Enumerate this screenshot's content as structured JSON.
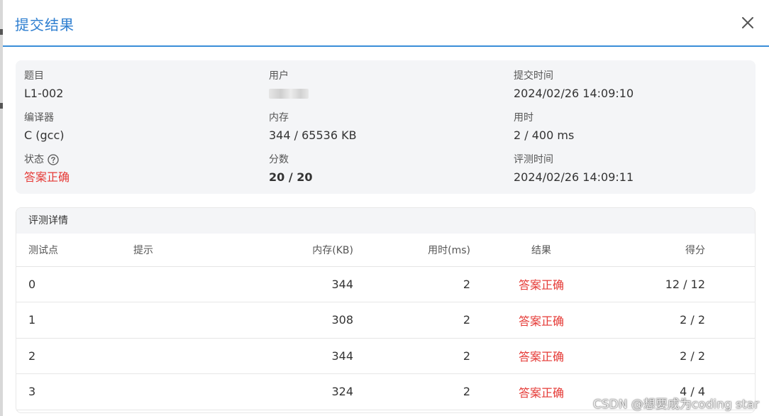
{
  "dialog": {
    "title": "提交结果",
    "accent": "#2f7fd0"
  },
  "info": {
    "problem": {
      "label": "题目",
      "value": "L1-002"
    },
    "user": {
      "label": "用户",
      "value": ""
    },
    "submit_time": {
      "label": "提交时间",
      "value": "2024/02/26 14:09:10"
    },
    "compiler": {
      "label": "编译器",
      "value": "C (gcc)"
    },
    "memory": {
      "label": "内存",
      "value": "344 / 65536 KB"
    },
    "time_used": {
      "label": "用时",
      "value": "2 / 400 ms"
    },
    "status": {
      "label": "状态",
      "value": "答案正确",
      "color": "#e53935"
    },
    "score": {
      "label": "分数",
      "value": "20 / 20"
    },
    "judge_time": {
      "label": "评测时间",
      "value": "2024/02/26 14:09:11"
    }
  },
  "detail": {
    "title": "评测详情",
    "columns": [
      "测试点",
      "提示",
      "内存(KB)",
      "用时(ms)",
      "结果",
      "得分"
    ],
    "rows": [
      {
        "case": "0",
        "hint": "",
        "memory": "344",
        "time": "2",
        "result": "答案正确",
        "score": "12 / 12"
      },
      {
        "case": "1",
        "hint": "",
        "memory": "308",
        "time": "2",
        "result": "答案正确",
        "score": "2 / 2"
      },
      {
        "case": "2",
        "hint": "",
        "memory": "344",
        "time": "2",
        "result": "答案正确",
        "score": "2 / 2"
      },
      {
        "case": "3",
        "hint": "",
        "memory": "324",
        "time": "2",
        "result": "答案正确",
        "score": "4 / 4"
      }
    ]
  },
  "watermark": "CSDN @想要成为coding star"
}
